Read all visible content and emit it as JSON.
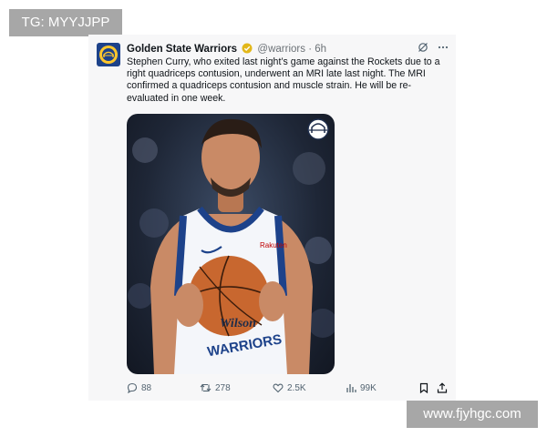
{
  "watermarks": {
    "top": "TG: MYYJJPP",
    "bottom": "www.fjyhgc.com"
  },
  "tweet": {
    "author_name": "Golden State Warriors",
    "handle": "@warriors",
    "separator": "·",
    "time": "6h",
    "avatar_icon": "warriors-logo-icon",
    "verified_icon": "gold-verified-badge-icon",
    "text": "Stephen Curry, who exited last night’s game against the Rockets due to a right quadriceps contusion, underwent an MRI late last night. The MRI confirmed a quadriceps contusion and muscle strain. He will be re-evaluated in one week.",
    "media": {
      "jersey_sponsor": "Rakuten",
      "jersey_team": "WARRIORS",
      "ball_brand": "Wilson",
      "badge_icon": "warriors-bridge-logo-icon"
    },
    "stats": {
      "replies": "88",
      "reposts": "278",
      "likes": "2.5K",
      "views": "99K"
    }
  },
  "colors": {
    "card_bg": "#f7f7f8",
    "text": "#0f1419",
    "muted": "#536471",
    "warriors_blue": "#1d428a",
    "warriors_gold": "#ffc72c",
    "tag_bg": "#a7a7a7"
  }
}
